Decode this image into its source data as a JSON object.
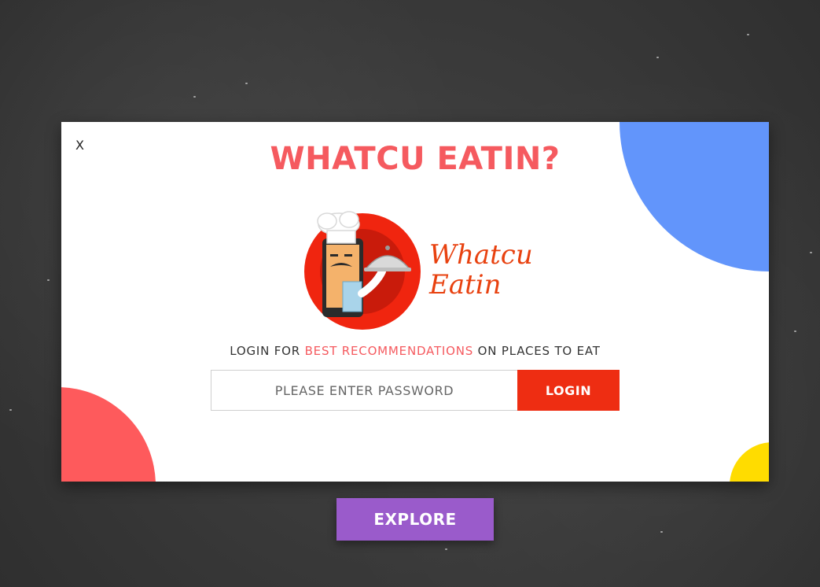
{
  "modal": {
    "close_label": "X",
    "title": "WHATCU EATIN?",
    "logo_text_line1": "Whatcu",
    "logo_text_line2": "Eatin",
    "tagline_prefix": "LOGIN FOR ",
    "tagline_highlight": "BEST RECOMMENDATIONS",
    "tagline_suffix": " ON PLACES TO EAT",
    "password_placeholder": "PLEASE ENTER PASSWORD",
    "password_value": "",
    "login_label": "LOGIN"
  },
  "explore_label": "EXPLORE",
  "colors": {
    "title": "#f55a5f",
    "highlight": "#f55a5f",
    "login_button": "#ee2d12",
    "explore_button": "#9a5bcb",
    "blob_blue": "#6295fb",
    "blob_red": "#fe5a5c",
    "blob_yellow": "#ffdc00",
    "logo_text": "#e8410f"
  },
  "icons": {
    "close": "close-icon",
    "logo": "chef-waiter-logo"
  }
}
